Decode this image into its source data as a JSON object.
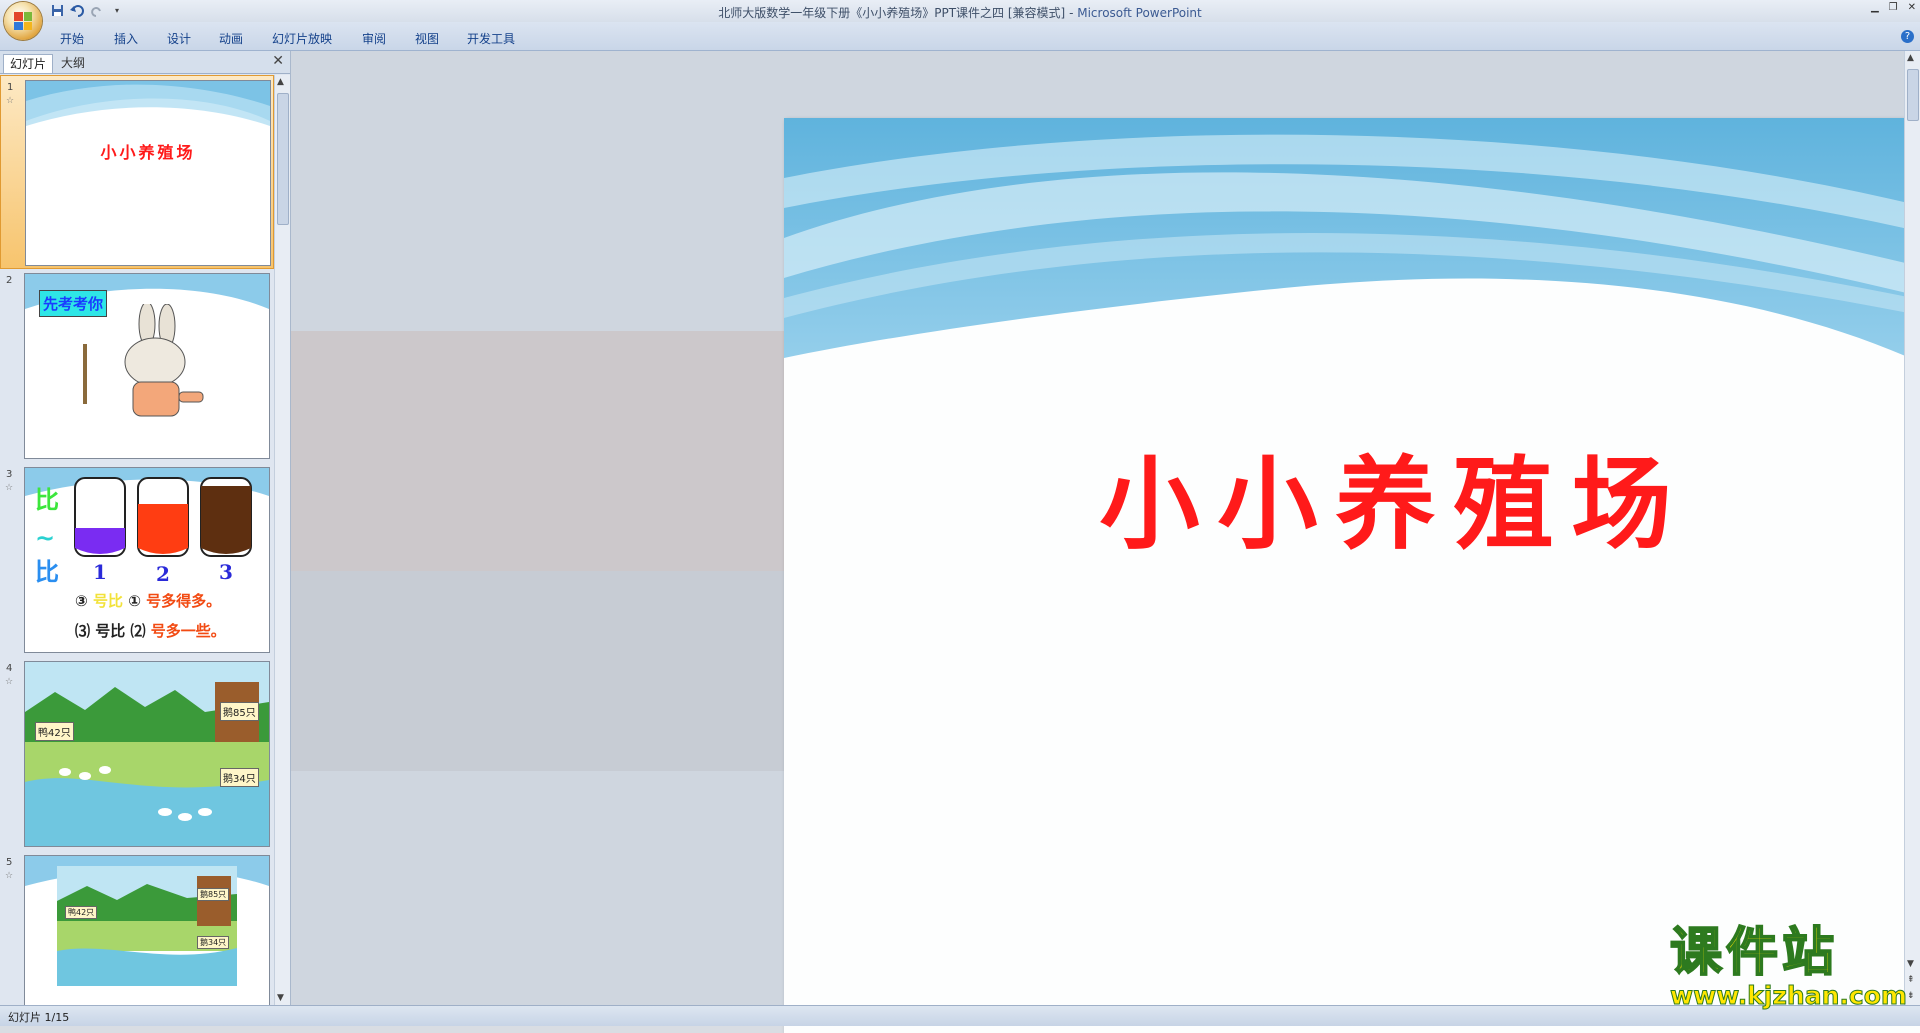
{
  "window": {
    "title": "北师大版数学一年级下册《小小养殖场》PPT课件之四 [兼容模式]",
    "app_name": "Microsoft PowerPoint",
    "title_separator": "-"
  },
  "quick_access": {
    "icons": [
      "save-icon",
      "undo-icon",
      "redo-icon",
      "customize-dropdown-icon"
    ]
  },
  "ribbon": {
    "tabs": [
      "开始",
      "插入",
      "设计",
      "动画",
      "幻灯片放映",
      "审阅",
      "视图",
      "开发工具"
    ]
  },
  "left_pane": {
    "tabs": [
      "幻灯片",
      "大纲"
    ],
    "thumbnails": [
      {
        "number": "1",
        "title": "小小养殖场",
        "selected": true
      },
      {
        "number": "2",
        "label": "先考考你",
        "selected": false
      },
      {
        "number": "3",
        "labels": [
          "1",
          "2",
          "3"
        ],
        "line1": [
          "③",
          "号比",
          "①",
          "号多得多。"
        ],
        "line2": [
          "⑶",
          "号比",
          "⑵",
          "号多一些。"
        ],
        "selected": false
      },
      {
        "number": "4",
        "labels": [
          "鸭42只",
          "鹅85只",
          "鹅34只"
        ],
        "selected": false
      },
      {
        "number": "5",
        "labels": [
          "鸭42只",
          "鹅85只",
          "鹅34只"
        ],
        "selected": false
      }
    ]
  },
  "slide": {
    "title": "小小养殖场",
    "title_color": "#ff1a1a"
  },
  "status": {
    "text": "幻灯片 1/15"
  },
  "watermark": {
    "title": "课件站",
    "url": "www.kjzhan.com"
  }
}
